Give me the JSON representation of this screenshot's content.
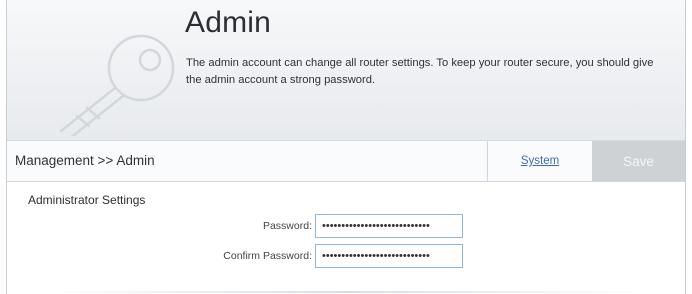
{
  "header": {
    "title": "Admin",
    "description": "The admin account can change all router settings. To keep your router secure, you should give the admin account a strong password."
  },
  "toolbar": {
    "breadcrumb": "Management >> Admin",
    "system_link": "System",
    "save_label": "Save"
  },
  "admin_settings": {
    "section_title": "Administrator Settings",
    "password_label": "Password:",
    "password_value": "••••••••••••••••••••••••••••",
    "confirm_label": "Confirm Password:",
    "confirm_value": "••••••••••••••••••••••••••••"
  },
  "icons": {
    "header_icon": "key-icon"
  },
  "colors": {
    "link": "#3d6ea8",
    "save_disabled": "#cfd2d5",
    "input_border": "#8cb8e0"
  }
}
